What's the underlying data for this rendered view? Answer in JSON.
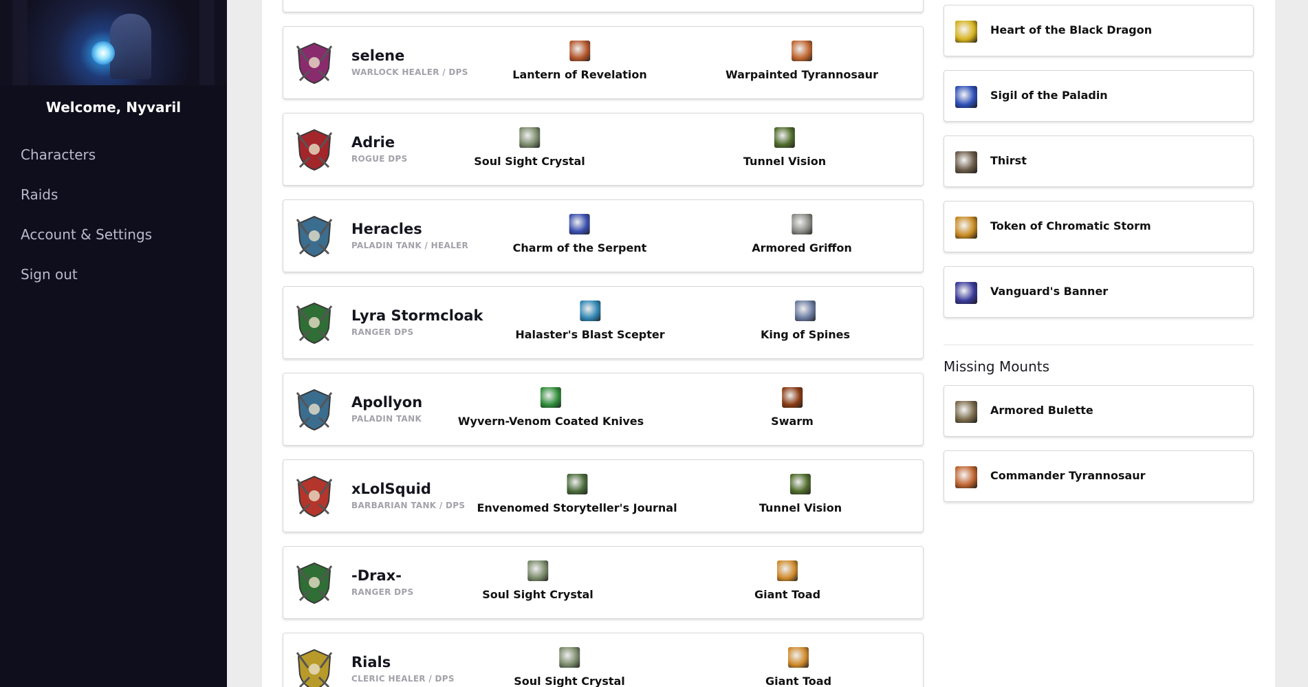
{
  "sidebar": {
    "welcome": "Welcome, Nyvaril",
    "nav": [
      {
        "label": "Characters"
      },
      {
        "label": "Raids"
      },
      {
        "label": "Account & Settings"
      },
      {
        "label": "Sign out"
      }
    ]
  },
  "characters": [
    {
      "name": "selene",
      "role": "WARLOCK HEALER / DPS",
      "emblem": "warlock-emblem-icon",
      "color": "#8a2b6e",
      "item1": {
        "label": "Lantern of Revelation",
        "icon": "lantern-icon",
        "color": "#b5552a"
      },
      "item2": {
        "label": "Warpainted Tyrannosaur",
        "icon": "tyrannosaur-icon",
        "color": "#c0652f"
      }
    },
    {
      "name": "Adrie",
      "role": "ROGUE DPS",
      "emblem": "rogue-emblem-icon",
      "color": "#a3262b",
      "item1": {
        "label": "Soul Sight Crystal",
        "icon": "crystal-skull-icon",
        "color": "#7a8a6a"
      },
      "item2": {
        "label": "Tunnel Vision",
        "icon": "tunnel-icon",
        "color": "#4f6b2a"
      }
    },
    {
      "name": "Heracles",
      "role": "PALADIN TANK / HEALER",
      "emblem": "paladin-emblem-icon",
      "color": "#3b6d8f",
      "item1": {
        "label": "Charm of the Serpent",
        "icon": "serpent-charm-icon",
        "color": "#3a4fb0"
      },
      "item2": {
        "label": "Armored Griffon",
        "icon": "griffon-icon",
        "color": "#8b8b86"
      }
    },
    {
      "name": "Lyra Stormcloak",
      "role": "RANGER DPS",
      "emblem": "ranger-emblem-icon",
      "color": "#2f6e34",
      "item1": {
        "label": "Halaster's Blast Scepter",
        "icon": "scepter-icon",
        "color": "#2f86b5"
      },
      "item2": {
        "label": "King of Spines",
        "icon": "spines-icon",
        "color": "#6a7aa0"
      }
    },
    {
      "name": "Apollyon",
      "role": "PALADIN TANK",
      "emblem": "paladin-emblem-icon",
      "color": "#3b6d8f",
      "item1": {
        "label": "Wyvern-Venom Coated Knives",
        "icon": "knives-icon",
        "color": "#2f8f3a"
      },
      "item2": {
        "label": "Swarm",
        "icon": "swarm-icon",
        "color": "#8a3a12"
      }
    },
    {
      "name": "xLolSquid",
      "role": "BARBARIAN TANK / DPS",
      "emblem": "barbarian-emblem-icon",
      "color": "#b3352b",
      "item1": {
        "label": "Envenomed Storyteller's Journal",
        "icon": "journal-icon",
        "color": "#4a6b3a"
      },
      "item2": {
        "label": "Tunnel Vision",
        "icon": "tunnel-icon",
        "color": "#4f6b2a"
      }
    },
    {
      "name": "-Drax-",
      "role": "RANGER DPS",
      "emblem": "ranger-emblem-icon",
      "color": "#2f6e34",
      "item1": {
        "label": "Soul Sight Crystal",
        "icon": "crystal-skull-icon",
        "color": "#7a8a6a"
      },
      "item2": {
        "label": "Giant Toad",
        "icon": "toad-icon",
        "color": "#d08a2a"
      }
    },
    {
      "name": "Rials",
      "role": "CLERIC HEALER / DPS",
      "emblem": "cleric-emblem-icon",
      "color": "#b89a2a",
      "item1": {
        "label": "Soul Sight Crystal",
        "icon": "crystal-skull-icon",
        "color": "#7a8a6a"
      },
      "item2": {
        "label": "Giant Toad",
        "icon": "toad-icon",
        "color": "#d08a2a"
      }
    }
  ],
  "right_items": [
    {
      "label": "Heart of the Black Dragon",
      "icon": "black-dragon-heart-icon",
      "color": "#d6b21e"
    },
    {
      "label": "Sigil of the Paladin",
      "icon": "paladin-sigil-icon",
      "color": "#2d4fb8"
    },
    {
      "label": "Thirst",
      "icon": "dagger-icon",
      "color": "#6b5a48"
    },
    {
      "label": "Token of Chromatic Storm",
      "icon": "chromatic-token-icon",
      "color": "#c88a22"
    },
    {
      "label": "Vanguard's Banner",
      "icon": "banner-icon",
      "color": "#3a3a9a"
    }
  ],
  "missing_mounts": {
    "title": "Missing Mounts",
    "items": [
      {
        "label": "Armored Bulette",
        "icon": "bulette-icon",
        "color": "#7a6a4a"
      },
      {
        "label": "Commander Tyrannosaur",
        "icon": "tyrannosaur-icon",
        "color": "#c0652f"
      }
    ]
  }
}
